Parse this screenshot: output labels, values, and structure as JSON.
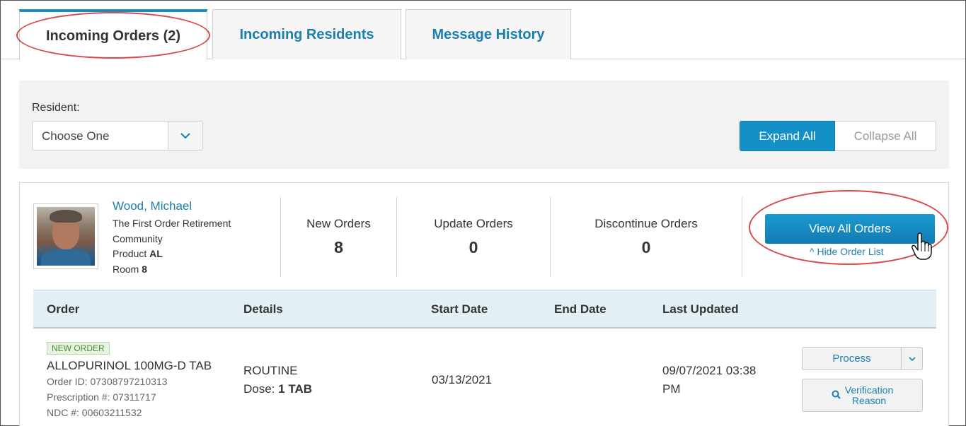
{
  "tabs": [
    {
      "label": "Incoming Orders (2)",
      "active": true
    },
    {
      "label": "Incoming Residents",
      "active": false
    },
    {
      "label": "Message History",
      "active": false
    }
  ],
  "filter": {
    "resident_label": "Resident:",
    "resident_select_value": "Choose One",
    "expand_all": "Expand All",
    "collapse_all": "Collapse All"
  },
  "resident": {
    "name": "Wood, Michael",
    "facility_line1": "The First Order Retirement",
    "facility_line2": "Community",
    "product_label": "Product",
    "product_value": "AL",
    "room_label": "Room",
    "room_value": "8",
    "stats": [
      {
        "label": "New Orders",
        "value": "8"
      },
      {
        "label": "Update Orders",
        "value": "0"
      },
      {
        "label": "Discontinue Orders",
        "value": "0"
      }
    ],
    "view_all_button": "View All Orders",
    "hide_order_list": "^ Hide Order List"
  },
  "table": {
    "headers": [
      "Order",
      "Details",
      "Start Date",
      "End Date",
      "Last Updated"
    ],
    "rows": [
      {
        "badge": "NEW ORDER",
        "drug": "ALLOPURINOL 100MG-D TAB",
        "order_id": "Order ID: 07308797210313",
        "prescription": "Prescription #: 07311717",
        "ndc": "NDC #: 00603211532",
        "details_type": "ROUTINE",
        "dose_label": "Dose:",
        "dose_value": "1 TAB",
        "start_date": "03/13/2021",
        "end_date": "",
        "last_updated_line1": "09/07/2021 03:38",
        "last_updated_line2": "PM",
        "process_button": "Process",
        "verification_button_line1": "Verification",
        "verification_button_line2": "Reason"
      }
    ]
  },
  "colors": {
    "accent_blue": "#1590c6",
    "link_blue": "#1a7fad",
    "annotation_red": "#d94a4a",
    "badge_green": "#4b8a3a",
    "header_bg": "#e2eff4"
  }
}
